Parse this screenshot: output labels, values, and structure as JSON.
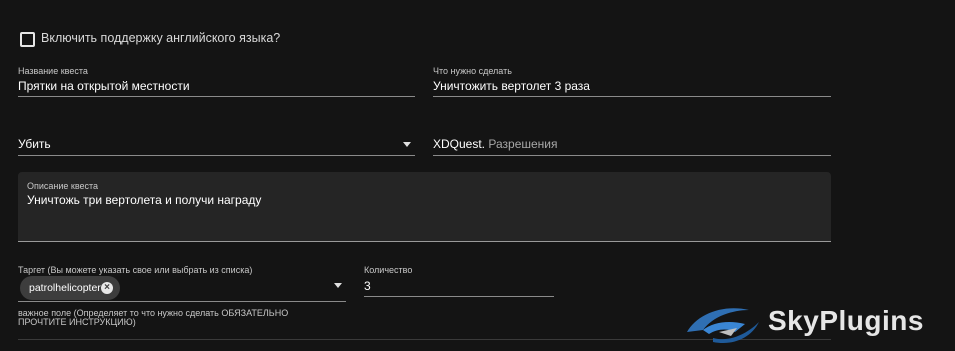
{
  "english_support": {
    "label": "Включить поддержку английского языка?",
    "checked": false
  },
  "quest_name": {
    "label": "Название квеста",
    "value": "Прятки на открытой местности"
  },
  "todo": {
    "label": "Что нужно сделать",
    "value": "Уничтожить вертолет 3 раза"
  },
  "action_select": {
    "value": "Убить"
  },
  "permissions": {
    "prefix": "XDQuest.",
    "placeholder": "Разрешения"
  },
  "description": {
    "label": "Описание квеста",
    "value": "Уничтожь три вертолета и получи награду"
  },
  "target": {
    "label": "Таргет (Вы можете указать свое или выбрать из списка)",
    "chip": "patrolhelicopter",
    "helper": "важное поле (Определяет то что нужно сделать ОБЯЗАТЕЛЬНО ПРОЧТИТЕ ИНСТРУКЦИЮ)"
  },
  "quantity": {
    "label": "Количество",
    "value": "3"
  },
  "watermark": {
    "text": "SkyPlugins"
  },
  "colors": {
    "background": "#141414",
    "field_fill": "#252525",
    "chip": "#3d3d3d",
    "logo_blue": "#2f6fb3"
  }
}
